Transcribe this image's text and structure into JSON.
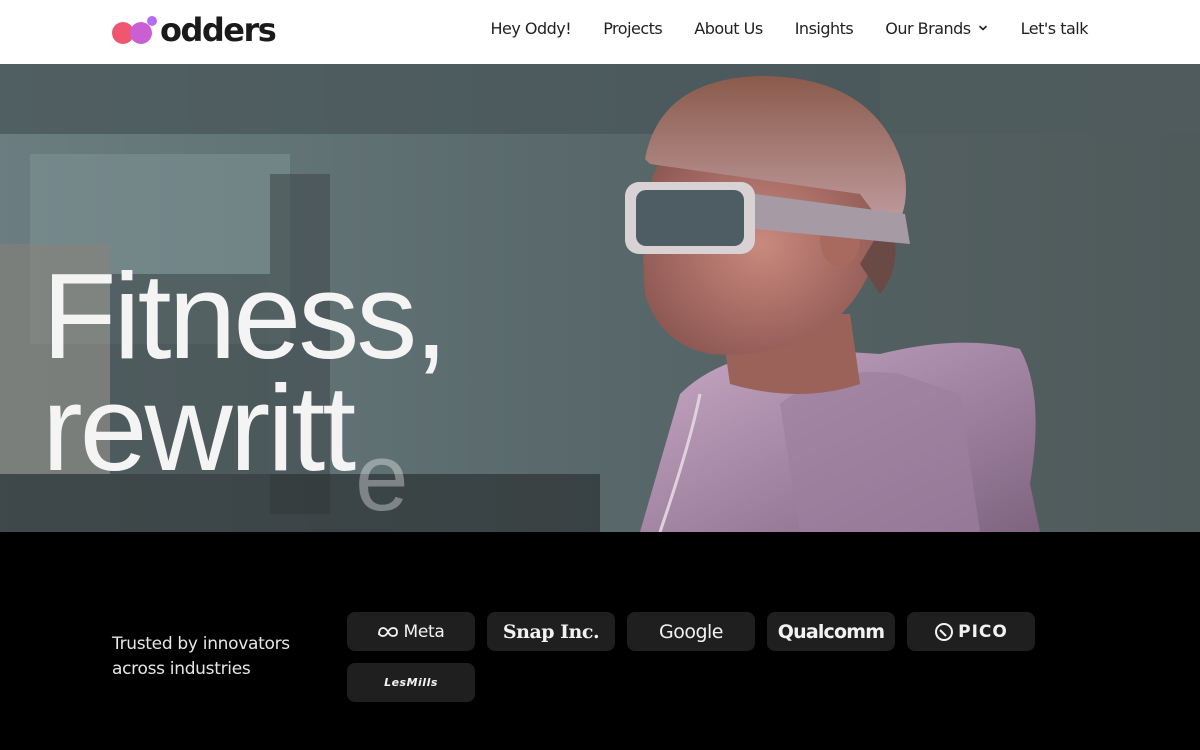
{
  "brand": {
    "name": "odders",
    "logo_colors": [
      "#f0566f",
      "#c95fd3",
      "#b46df0"
    ]
  },
  "nav": {
    "items": [
      {
        "label": "Hey Oddy!"
      },
      {
        "label": "Projects"
      },
      {
        "label": "About Us"
      },
      {
        "label": "Insights"
      },
      {
        "label": "Our Brands",
        "has_dropdown": true,
        "icon": "chevron-down-icon"
      },
      {
        "label": "Let's talk"
      }
    ]
  },
  "hero": {
    "headline_line1": "Fitness,",
    "headline_line2": "rewritt",
    "headline_ghost_letter": "e"
  },
  "trusted": {
    "heading": "Trusted by innovators across industries",
    "logos": [
      {
        "label": "Meta",
        "icon": "meta-infinity-icon"
      },
      {
        "label": "Snap Inc."
      },
      {
        "label": "Google"
      },
      {
        "label": "Qualcomm"
      },
      {
        "label": "PICO",
        "icon": "pico-icon"
      },
      {
        "label": "LesMills"
      }
    ]
  }
}
